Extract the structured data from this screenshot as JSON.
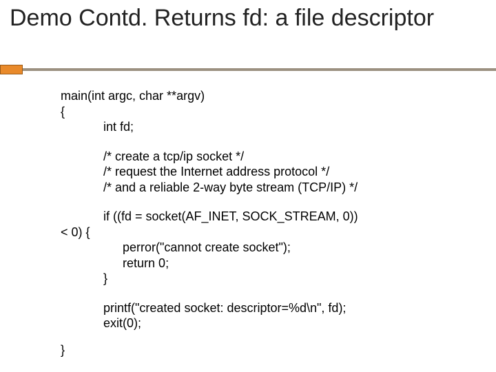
{
  "title": "Demo Contd. Returns fd: a file descriptor",
  "code": {
    "l1": "main(int argc, char **argv)",
    "l2": "{",
    "l3": "int fd;",
    "l4": "/* create a tcp/ip socket */",
    "l5": "/* request the Internet address protocol */",
    "l6": "/* and a reliable 2-way byte stream (TCP/IP) */",
    "l7": "if ((fd = socket(AF_INET, SOCK_STREAM, 0))",
    "l8": "< 0) {",
    "l9": "perror(\"cannot create socket\");",
    "l10": "return 0;",
    "l11": "}",
    "l12": "printf(\"created socket: descriptor=%d\\n\", fd);",
    "l13": "exit(0);",
    "l14": "}"
  }
}
